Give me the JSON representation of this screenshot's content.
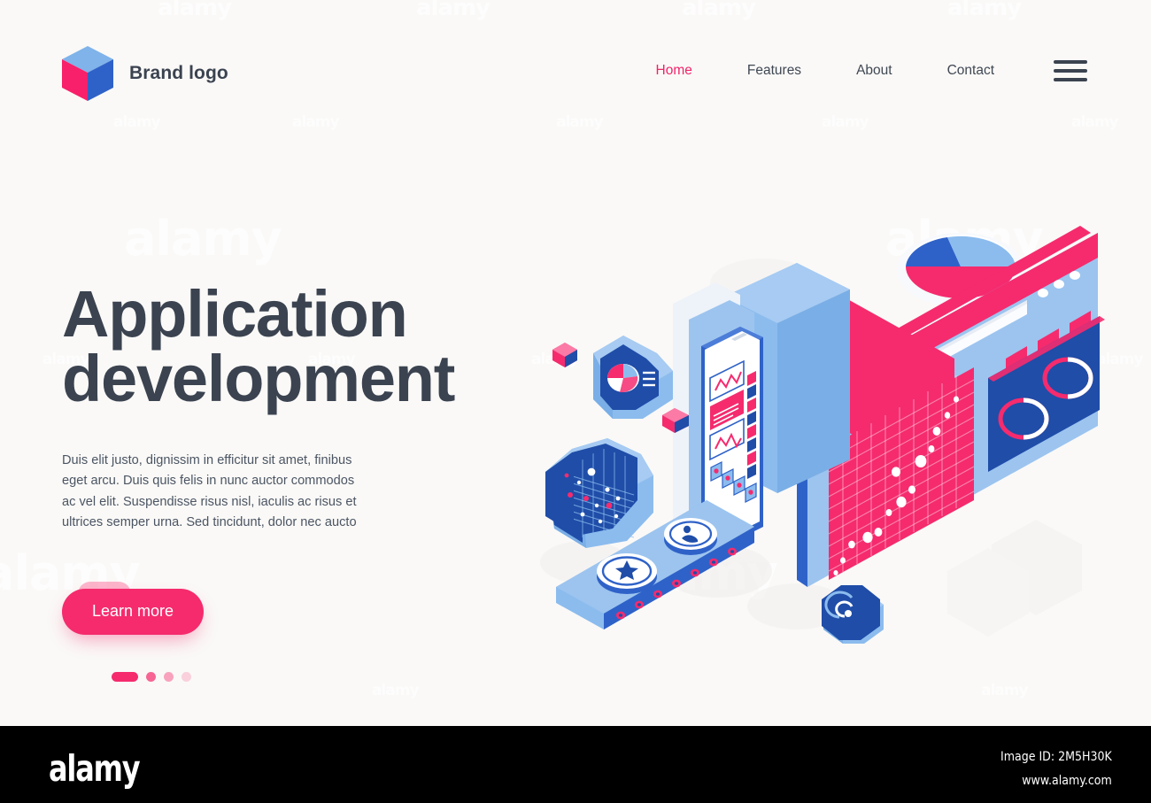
{
  "brand": {
    "name": "Brand logo",
    "logo_icon": "isometric-cube-icon",
    "colors": {
      "top": "#7fb3ea",
      "left": "#f8206a",
      "right": "#2f62c8"
    }
  },
  "nav": {
    "items": [
      {
        "label": "Home",
        "active": true
      },
      {
        "label": "Features",
        "active": false
      },
      {
        "label": "About",
        "active": false
      },
      {
        "label": "Contact",
        "active": false
      }
    ],
    "menu_icon": "hamburger-menu-icon"
  },
  "hero": {
    "title_line1": "Application",
    "title_line2": "development",
    "paragraph": "Duis elit justo, dignissim in efficitur sit amet, finibus eget arcu. Duis quis felis in nunc auctor commodos ac vel elit. Suspendisse risus nisl, iaculis ac risus et ultrices semper urna. Sed tincidunt, dolor nec aucto",
    "cta_label": "Learn more",
    "carousel": {
      "total": 4,
      "active_index": 0
    }
  },
  "illustration": {
    "name": "isometric-app-development-illustration",
    "elements": [
      "pie-chart-disc",
      "browser-window-card",
      "scatter-grid-panel",
      "donut-rings-panel",
      "smartphone-dashboard",
      "conveyor-belt",
      "star-badge",
      "user-badge",
      "octagon-donut-block",
      "octagon-grid-block",
      "octagon-spiral-block",
      "small-pink-blocks"
    ]
  },
  "colors": {
    "background": "#faf9f7",
    "accent_pink": "#f52b6e",
    "accent_blue": "#2f62c8",
    "light_blue": "#8cbcee",
    "text_dark": "#3b4350"
  },
  "watermarks": {
    "text": "alamy"
  },
  "footer": {
    "logo": "alamy",
    "image_id": "Image ID: 2M5H30K",
    "url": "www.alamy.com"
  }
}
